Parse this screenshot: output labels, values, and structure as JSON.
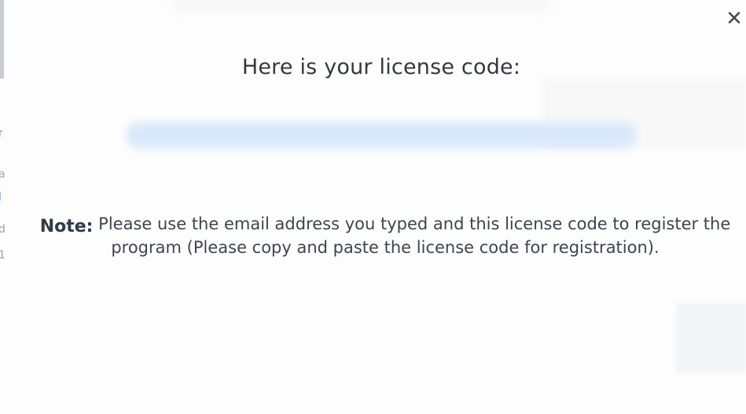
{
  "dialog": {
    "close_glyph": "✕",
    "title": "Here is your license code:",
    "license_code": "",
    "note_label": "Note:",
    "note_text": "Please use the email address you typed and this license code to register the program (Please copy and paste the license code for registration)."
  },
  "background": {
    "fragments": [
      "r",
      "a",
      "l",
      "d",
      "1"
    ]
  },
  "colors": {
    "title_text": "#333940",
    "note_text": "#3c4550",
    "close_icon": "#444a52",
    "license_highlight": "#cfe3f7",
    "link_blue": "#4a8fd8"
  }
}
